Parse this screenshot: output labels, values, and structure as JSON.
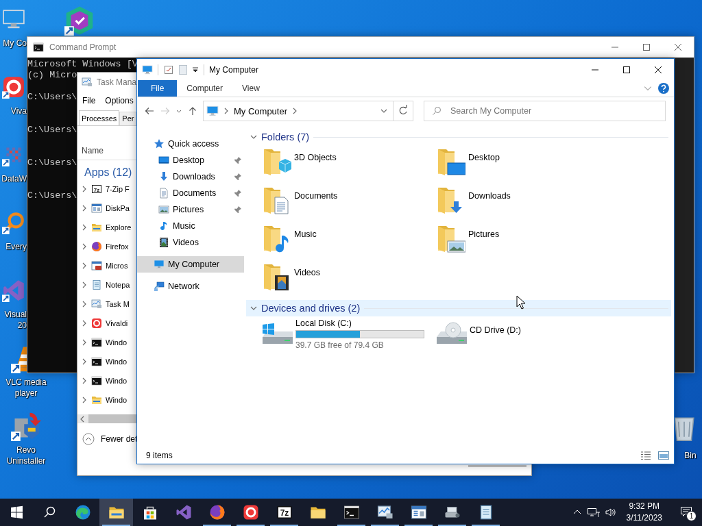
{
  "desktop_icons": [
    {
      "kind": "computer",
      "shortcut": false,
      "covered": true,
      "label": [
        "My Co"
      ]
    },
    {
      "kind": "vivaldi",
      "shortcut": true,
      "covered": true,
      "label": [
        "Viva"
      ]
    },
    {
      "kind": "datawrapper",
      "shortcut": true,
      "covered": true,
      "label": [
        "DataW"
      ]
    },
    {
      "kind": "everything",
      "shortcut": true,
      "covered": true,
      "label": [
        "Every"
      ]
    },
    {
      "kind": "vs",
      "shortcut": true,
      "covered": true,
      "label": [
        "Visual",
        "20"
      ]
    },
    {
      "kind": "vlc",
      "shortcut": true,
      "covered": false,
      "label": [
        "VLC media",
        "player"
      ]
    },
    {
      "kind": "revo",
      "shortcut": true,
      "covered": false,
      "label": [
        "Revo",
        "Uninstaller"
      ]
    }
  ],
  "desktop_extra": [
    {
      "kind": "shield",
      "shortcut": true
    },
    {
      "kind": "recycle",
      "shortcut": false,
      "label": [
        "Bin"
      ]
    }
  ],
  "cmd": {
    "title": "Command Prompt",
    "blocks": [
      [
        "Microsoft Windows [V",
        "(c) Micro"
      ],
      [
        "C:\\Users\\"
      ],
      [
        "C:\\Users\\"
      ],
      [
        "C:\\Users\\"
      ],
      [
        "C:\\Users\\"
      ]
    ]
  },
  "taskmgr": {
    "title": "Task Mana",
    "menu": [
      "File",
      "Options"
    ],
    "tabs": [
      {
        "label": "Processes",
        "selected": true
      },
      {
        "label": "Per",
        "selected": false
      }
    ],
    "column": "Name",
    "group": "Apps (12)",
    "apps": [
      {
        "name": "7-Zip F",
        "kind": "sevenzip",
        "icon_text": "7z"
      },
      {
        "name": "DiskPa",
        "kind": "diskpart"
      },
      {
        "name": "Explore",
        "kind": "explorer"
      },
      {
        "name": "Firefox",
        "kind": "firefox"
      },
      {
        "name": "Micros",
        "kind": "msapp"
      },
      {
        "name": "Notepa",
        "kind": "notepad"
      },
      {
        "name": "Task M",
        "kind": "taskmgr"
      },
      {
        "name": "Vivaldi",
        "kind": "vivaldi"
      },
      {
        "name": "Windo",
        "kind": "cmd"
      },
      {
        "name": "Windo",
        "kind": "cmd"
      },
      {
        "name": "Windo",
        "kind": "cmd"
      },
      {
        "name": "Windo",
        "kind": "explorer"
      }
    ],
    "footer": "Fewer det"
  },
  "explorer": {
    "title": "My Computer",
    "ribbon_tabs": [
      {
        "label": "File",
        "selected": true
      },
      {
        "label": "Computer",
        "selected": false
      },
      {
        "label": "View",
        "selected": false
      }
    ],
    "address": "My Computer",
    "search": {
      "placeholder": "Search My Computer"
    },
    "nav": [
      {
        "label": "Quick access",
        "kind": "star",
        "selected": false,
        "children": [
          {
            "label": "Desktop",
            "kind": "desktop",
            "pinned": true,
            "selected": false
          },
          {
            "label": "Downloads",
            "kind": "downloads",
            "pinned": true,
            "selected": false
          },
          {
            "label": "Documents",
            "kind": "documents",
            "pinned": true,
            "selected": false
          },
          {
            "label": "Pictures",
            "kind": "pictures",
            "pinned": true,
            "selected": false
          },
          {
            "label": "Music",
            "kind": "music",
            "pinned": false,
            "selected": false
          },
          {
            "label": "Videos",
            "kind": "videos",
            "pinned": false,
            "selected": false
          }
        ]
      },
      {
        "label": "My Computer",
        "kind": "computer",
        "selected": true
      },
      {
        "label": "Network",
        "kind": "network",
        "selected": false
      }
    ],
    "folders": {
      "title": "Folders (7)",
      "expanded": true,
      "highlighted": false,
      "items": [
        {
          "name": "3D Objects",
          "kind": "cube"
        },
        {
          "name": "Desktop",
          "kind": "desktop"
        },
        {
          "name": "Documents",
          "kind": "documents"
        },
        {
          "name": "Downloads",
          "kind": "downloads"
        },
        {
          "name": "Music",
          "kind": "music"
        },
        {
          "name": "Pictures",
          "kind": "pictures"
        },
        {
          "name": "Videos",
          "kind": "videos"
        }
      ]
    },
    "drives": {
      "title": "Devices and drives (2)",
      "expanded": true,
      "highlighted": true,
      "items": [
        {
          "name": "Local Disk (C:)",
          "kind": "system",
          "level": 0.5,
          "free": "39.7 GB free of 79.4 GB"
        },
        {
          "name": "CD Drive (D:)",
          "kind": "cd"
        }
      ]
    },
    "status": "9 items"
  },
  "taskbar": {
    "apps": [
      {
        "kind": "edge",
        "running": false,
        "active": false
      },
      {
        "kind": "explorer",
        "running": true,
        "active": true
      },
      {
        "kind": "store",
        "running": false,
        "active": false
      },
      {
        "kind": "vs",
        "running": false,
        "active": false
      },
      {
        "kind": "firefox",
        "running": true,
        "active": false
      },
      {
        "kind": "vivaldi",
        "running": true,
        "active": false
      },
      {
        "kind": "sevenzip",
        "running": true,
        "active": false,
        "icon_text": "7z"
      },
      {
        "kind": "folder",
        "running": false,
        "active": false
      },
      {
        "kind": "cmd",
        "running": true,
        "active": false
      },
      {
        "kind": "taskmgr",
        "running": true,
        "active": false
      },
      {
        "kind": "diskpart",
        "running": true,
        "active": false
      },
      {
        "kind": "drive",
        "running": true,
        "active": false
      },
      {
        "kind": "notepad",
        "running": true,
        "active": false
      }
    ],
    "time": "9:32 PM",
    "date": "3/11/2023",
    "notifications": "1"
  }
}
